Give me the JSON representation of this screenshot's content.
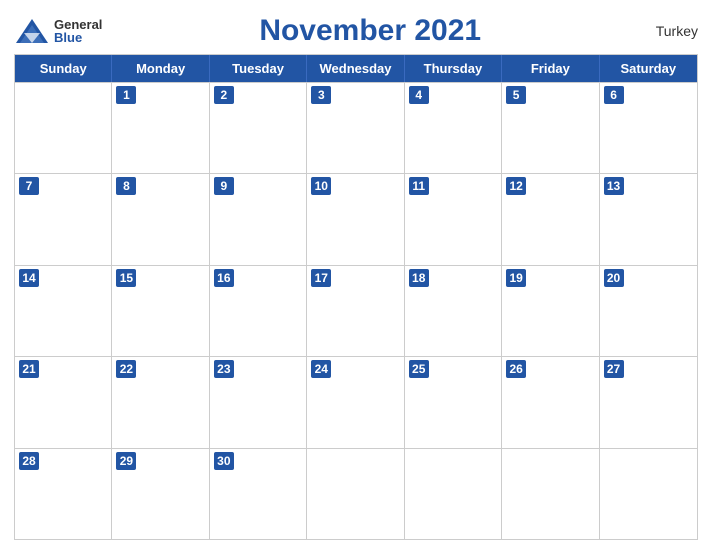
{
  "header": {
    "logo": {
      "general": "General",
      "blue": "Blue",
      "icon_shape": "triangle"
    },
    "title": "November 2021",
    "country": "Turkey"
  },
  "calendar": {
    "days_of_week": [
      "Sunday",
      "Monday",
      "Tuesday",
      "Wednesday",
      "Thursday",
      "Friday",
      "Saturday"
    ],
    "weeks": [
      [
        null,
        1,
        2,
        3,
        4,
        5,
        6
      ],
      [
        7,
        8,
        9,
        10,
        11,
        12,
        13
      ],
      [
        14,
        15,
        16,
        17,
        18,
        19,
        20
      ],
      [
        21,
        22,
        23,
        24,
        25,
        26,
        27
      ],
      [
        28,
        29,
        30,
        null,
        null,
        null,
        null
      ]
    ]
  },
  "colors": {
    "accent": "#2255a4",
    "border": "#cccccc",
    "text_dark": "#333333",
    "text_white": "#ffffff"
  }
}
